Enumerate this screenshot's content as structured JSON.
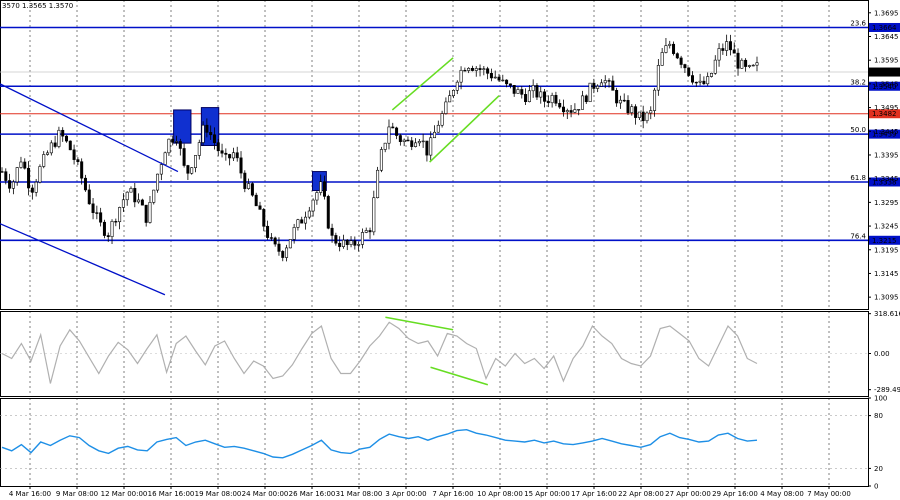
{
  "chart_data": {
    "type": "candlestick",
    "header": "3570 1.3565 1.3570",
    "price_panel": {
      "y_ticks": [
        "1.3695",
        "1.3645",
        "1.3595",
        "1.3545",
        "1.3495",
        "1.3445",
        "1.3395",
        "1.3345",
        "1.3295",
        "1.3245",
        "1.3195",
        "1.3145",
        "1.3095"
      ],
      "ylim": [
        1.307,
        1.3722
      ],
      "current_price": "1.3570",
      "fib_levels": [
        {
          "label": "23.6",
          "price": 1.3664,
          "price_label": "1.3664"
        },
        {
          "label": "38.2",
          "price": 1.354,
          "price_label": "1.3540"
        },
        {
          "label": "50.0",
          "price": 1.3439,
          "price_label": "1.3439"
        },
        {
          "label": "61.8",
          "price": 1.3338,
          "price_label": "1.3338"
        },
        {
          "label": "76.4",
          "price": 1.3215,
          "price_label": "1.3215"
        }
      ],
      "horizontal_red": {
        "price": 1.3482,
        "price_label": "1.3482"
      },
      "close_path": [
        1.336,
        1.333,
        1.339,
        1.332,
        1.337,
        1.341,
        1.344,
        1.341,
        1.336,
        1.33,
        1.325,
        1.323,
        1.328,
        1.332,
        1.33,
        1.326,
        1.335,
        1.342,
        1.344,
        1.335,
        1.34,
        1.346,
        1.342,
        1.338,
        1.34,
        1.334,
        1.33,
        1.325,
        1.32,
        1.319,
        1.323,
        1.326,
        1.33,
        1.333,
        1.322,
        1.321,
        1.32,
        1.322,
        1.324,
        1.338,
        1.346,
        1.343,
        1.342,
        1.344,
        1.34,
        1.346,
        1.35,
        1.356,
        1.359,
        1.358,
        1.357,
        1.356,
        1.354,
        1.353,
        1.352,
        1.353,
        1.351,
        1.352,
        1.35,
        1.349,
        1.351,
        1.354,
        1.356,
        1.353,
        1.35,
        1.349,
        1.347,
        1.348,
        1.36,
        1.363,
        1.36,
        1.357,
        1.354,
        1.355,
        1.361,
        1.363,
        1.359,
        1.357,
        1.358
      ],
      "boxes": [
        {
          "x0": 0.2,
          "x1": 0.22,
          "p_hi": 1.349,
          "p_lo": 1.342
        },
        {
          "x0": 0.232,
          "x1": 0.252,
          "p_hi": 1.3495,
          "p_lo": 1.3415
        },
        {
          "x0": 0.36,
          "x1": 0.376,
          "p_hi": 1.336,
          "p_lo": 1.332
        }
      ],
      "channel_blue": [
        {
          "x0": 0.0,
          "p0": 1.3545,
          "x1": 0.205,
          "p1": 1.336
        },
        {
          "x0": 0.0,
          "p0": 1.325,
          "x1": 0.19,
          "p1": 1.31
        }
      ],
      "channel_green": [
        {
          "x0": 0.452,
          "p0": 1.349,
          "x1": 0.522,
          "p1": 1.36
        },
        {
          "x0": 0.495,
          "p0": 1.338,
          "x1": 0.575,
          "p1": 1.352
        }
      ]
    },
    "cci_panel": {
      "y_ticks": [
        "318.6161",
        "0.00",
        "-289.493"
      ],
      "ylim": [
        -340,
        340
      ],
      "values": [
        0,
        -40,
        80,
        -60,
        150,
        -240,
        60,
        190,
        100,
        -30,
        -160,
        -20,
        90,
        30,
        -80,
        40,
        150,
        -150,
        80,
        140,
        20,
        -90,
        60,
        100,
        -40,
        -160,
        -60,
        -100,
        -200,
        -180,
        -90,
        40,
        160,
        220,
        -40,
        -160,
        -160,
        -60,
        60,
        140,
        250,
        200,
        120,
        80,
        100,
        -20,
        160,
        140,
        80,
        40,
        -200,
        -40,
        -100,
        0,
        -80,
        -40,
        -120,
        -20,
        -220,
        -40,
        60,
        220,
        140,
        80,
        -40,
        -80,
        -100,
        -20,
        200,
        220,
        160,
        100,
        -40,
        -100,
        60,
        220,
        140,
        -40,
        -80
      ],
      "divergence": [
        {
          "x0": 0.444,
          "v0": 290,
          "x1": 0.522,
          "v1": 190
        },
        {
          "x0": 0.496,
          "v0": -110,
          "x1": 0.562,
          "v1": -250
        }
      ]
    },
    "rsi_panel": {
      "y_ticks": [
        "100",
        "80",
        "20",
        "0"
      ],
      "ylim": [
        0,
        100
      ],
      "values": [
        44,
        40,
        47,
        38,
        50,
        46,
        52,
        57,
        55,
        46,
        40,
        37,
        43,
        45,
        41,
        40,
        50,
        53,
        55,
        46,
        50,
        52,
        48,
        44,
        45,
        43,
        40,
        37,
        33,
        32,
        36,
        41,
        46,
        52,
        41,
        38,
        37,
        42,
        44,
        53,
        59,
        56,
        54,
        56,
        52,
        56,
        59,
        63,
        64,
        60,
        58,
        55,
        52,
        51,
        50,
        52,
        49,
        51,
        48,
        47,
        49,
        51,
        54,
        51,
        48,
        46,
        44,
        47,
        56,
        60,
        55,
        53,
        50,
        51,
        58,
        60,
        54,
        51,
        52
      ]
    },
    "x_ticks": [
      "4 Mar 16:00",
      "9 Mar 08:00",
      "12 Mar 00:00",
      "16 Mar 16:00",
      "19 Mar 08:00",
      "24 Mar 00:00",
      "26 Mar 16:00",
      "31 Mar 08:00",
      "3 Apr 00:00",
      "7 Apr 16:00",
      "10 Apr 08:00",
      "15 Apr 00:00",
      "17 Apr 16:00",
      "22 Apr 08:00",
      "27 Apr 00:00",
      "29 Apr 16:00",
      "4 May 08:00",
      "7 May 00:00"
    ]
  }
}
